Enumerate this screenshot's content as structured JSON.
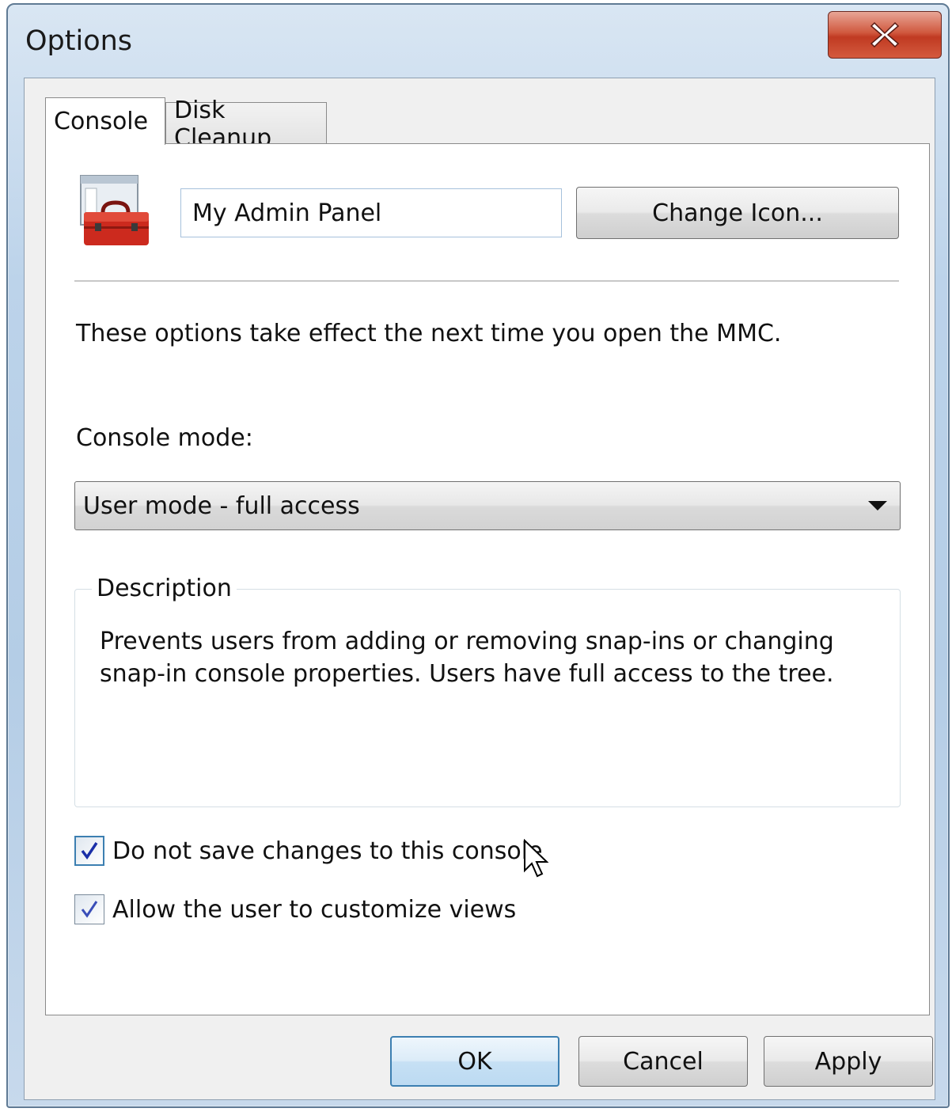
{
  "window": {
    "title": "Options"
  },
  "tabs": [
    {
      "label": "Console",
      "selected": true
    },
    {
      "label": "Disk Cleanup",
      "selected": false
    }
  ],
  "console": {
    "name_value": "My Admin Panel",
    "change_icon_label": "Change Icon...",
    "note": "These options take effect the next time you open the MMC.",
    "mode_label": "Console mode:",
    "mode_selected": "User mode - full access",
    "description_legend": "Description",
    "description_text": "Prevents users from adding or removing snap-ins or changing snap-in console properties. Users have full access to the tree.",
    "checkboxes": [
      {
        "label": "Do not save changes to this console",
        "checked": true
      },
      {
        "label": "Allow the user to customize views",
        "checked": true
      }
    ]
  },
  "buttons": {
    "ok": "OK",
    "cancel": "Cancel",
    "apply": "Apply"
  },
  "icons": {
    "app": "toolbox-icon",
    "close": "close-icon",
    "cursor": "mouse-pointer-icon"
  },
  "colors": {
    "close_red": "#c8432b",
    "focus_blue": "#3c7fb1",
    "check_blue": "#1a2fa8"
  }
}
